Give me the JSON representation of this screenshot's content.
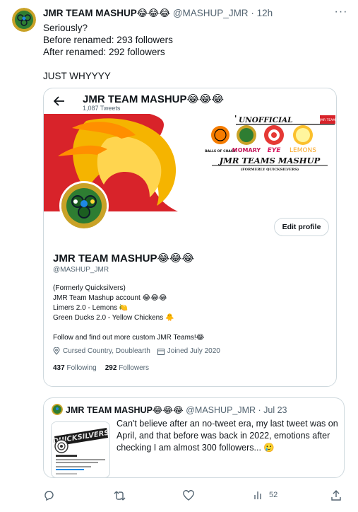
{
  "tweet": {
    "name": "JMR TEAM MASHUP😂😂😂",
    "handle": "@MASHUP_JMR",
    "sep": " · ",
    "time": "12h",
    "lines": [
      "Seriously?",
      "Before renamed: 293 followers",
      "After renamed: 292 followers",
      "",
      "JUST WHYYYY"
    ]
  },
  "card": {
    "title": "JMR TEAM MASHUP😂😂😂",
    "tweets": "1,087 Tweets",
    "edit_label": "Edit profile",
    "name": "JMR TEAM MASHUP😂😂😂",
    "handle": "@MASHUP_JMR",
    "bio": [
      "(Formerly Quicksilvers)",
      "JMR Team Mashup account 😂😂😂",
      "Limers 2.0 - Lemons 🍋",
      "Green Ducks 2.0 - Yellow Chickens 🐥",
      "",
      "Follow and find out more custom JMR Teams!😂"
    ],
    "location": "Cursed Country, Doublearth",
    "joined": "Joined July 2020",
    "following_count": "437",
    "following_label": "Following",
    "followers_count": "292",
    "followers_label": "Followers",
    "banner": {
      "unofficial": "UNOFFICIAL",
      "tag": "JMR TEAM",
      "teams": [
        "BALLS OF CHAOS",
        "MOMARY",
        "EYE",
        "LEMONS"
      ],
      "headline": "JMR TEAMS MASHUP",
      "subline": "(FORMERLY QUICKSILVERS)"
    }
  },
  "quote": {
    "name": "JMR TEAM MASHUP😂😂😂",
    "handle": "@MASHUP_JMR",
    "sep": " · ",
    "date": "Jul 23",
    "text": "Can't believe after an no-tweet era, my last tweet was on April, and that before was back in 2022, emotions after checking I am almost 300 followers... 🥲",
    "thumb_title": "QUICKSILVERS"
  },
  "actions": {
    "views": "52"
  },
  "colors": {
    "text": "#0f1419",
    "muted": "#536471",
    "border": "#cfd9de",
    "avatar_gold": "#c9a227",
    "avatar_green": "#2e7d32"
  }
}
